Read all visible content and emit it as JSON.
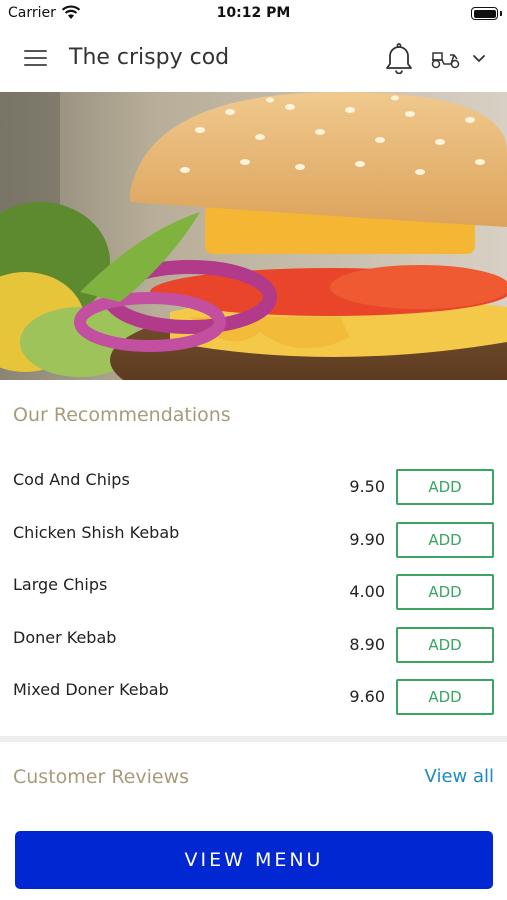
{
  "status_bar": {
    "carrier": "Carrier",
    "time": "10:12 PM"
  },
  "header": {
    "title": "The crispy cod",
    "icons": [
      "menu-icon",
      "bell-icon",
      "delivery-scooter-icon",
      "chevron-down-icon"
    ]
  },
  "hero": {
    "image": "burger-photo"
  },
  "recommendations": {
    "title": "Our Recommendations",
    "items": [
      {
        "name": "Cod And Chips",
        "price": "9.50",
        "button": "ADD"
      },
      {
        "name": "Chicken Shish Kebab",
        "price": "9.90",
        "button": "ADD"
      },
      {
        "name": "Large Chips",
        "price": "4.00",
        "button": "ADD"
      },
      {
        "name": "Doner Kebab",
        "price": "8.90",
        "button": "ADD"
      },
      {
        "name": "Mixed Doner Kebab",
        "price": "9.60",
        "button": "ADD"
      }
    ]
  },
  "reviews": {
    "title": "Customer Reviews",
    "view_all": "View all"
  },
  "footer": {
    "view_menu": "VIEW MENU"
  },
  "colors": {
    "accent_green": "#3aa563",
    "section_title": "#a89a7c",
    "link_blue": "#1f8ac1",
    "primary_button": "#0027d2"
  }
}
